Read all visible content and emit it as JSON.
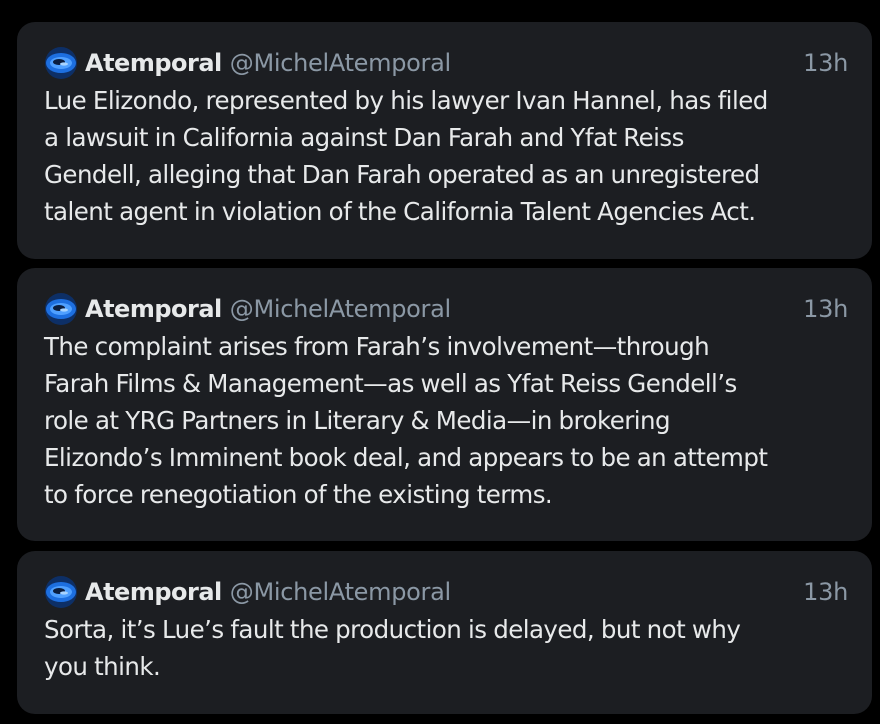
{
  "colors": {
    "background": "#000000",
    "card": "#1c1e22",
    "primary_text": "#e7e9ea",
    "secondary_text": "#8b98a5",
    "avatar_blue": "#1d6fe0"
  },
  "posts": [
    {
      "avatar_icon": "blue-swirl-icon",
      "display_name": "Atemporal",
      "handle": "@MichelAtemporal",
      "time": "13h",
      "lines": [
        "Lue Elizondo, represented by his lawyer Ivan Hannel, has filed",
        "a lawsuit in California against Dan Farah and Yfat Reiss",
        "Gendell, alleging that Dan Farah operated as an unregistered",
        "talent agent in violation of the California Talent Agencies Act."
      ]
    },
    {
      "avatar_icon": "blue-swirl-icon",
      "display_name": "Atemporal",
      "handle": "@MichelAtemporal",
      "time": "13h",
      "lines": [
        "The complaint arises from Farah’s involvement—through",
        "Farah Films & Management—as well as Yfat Reiss Gendell’s",
        "role at YRG Partners in Literary & Media—in brokering",
        "Elizondo’s Imminent book deal, and appears to be an attempt",
        "to force renegotiation of the existing terms."
      ]
    },
    {
      "avatar_icon": "blue-swirl-icon",
      "display_name": "Atemporal",
      "handle": "@MichelAtemporal",
      "time": "13h",
      "lines": [
        "Sorta, it’s Lue’s fault the production is delayed, but not why",
        "you think."
      ]
    }
  ]
}
